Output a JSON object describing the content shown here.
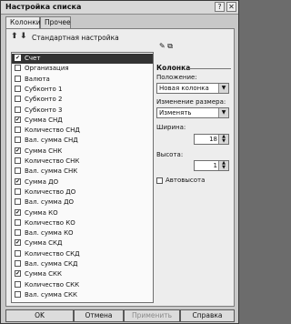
{
  "window": {
    "title": "Настройка списка",
    "help_glyph": "?",
    "close_glyph": "✕"
  },
  "tabs": [
    {
      "label": "Колонки",
      "active": true
    },
    {
      "label": "Прочее",
      "active": false
    }
  ],
  "toolbar": {
    "up_glyph": "⬆",
    "down_glyph": "⬇",
    "label": "Стандартная настройка"
  },
  "list": [
    {
      "label": "Счет",
      "checked": true,
      "selected": true
    },
    {
      "label": "Организация",
      "checked": false
    },
    {
      "label": "Валюта",
      "checked": false
    },
    {
      "label": "Субконто 1",
      "checked": false
    },
    {
      "label": "Субконто 2",
      "checked": false
    },
    {
      "label": "Субконто 3",
      "checked": false
    },
    {
      "label": "Сумма СНД",
      "checked": true
    },
    {
      "label": "Количество СНД",
      "checked": false
    },
    {
      "label": "Вал. сумма СНД",
      "checked": false
    },
    {
      "label": "Сумма СНК",
      "checked": true
    },
    {
      "label": "Количество СНК",
      "checked": false
    },
    {
      "label": "Вал. сумма СНК",
      "checked": false
    },
    {
      "label": "Сумма ДО",
      "checked": true
    },
    {
      "label": "Количество ДО",
      "checked": false
    },
    {
      "label": "Вал. сумма ДО",
      "checked": false
    },
    {
      "label": "Сумма КО",
      "checked": true
    },
    {
      "label": "Количество КО",
      "checked": false
    },
    {
      "label": "Вал. сумма КО",
      "checked": false
    },
    {
      "label": "Сумма СКД",
      "checked": true
    },
    {
      "label": "Количество СКД",
      "checked": false
    },
    {
      "label": "Вал. сумма СКД",
      "checked": false
    },
    {
      "label": "Сумма СКК",
      "checked": true
    },
    {
      "label": "Количество СКК",
      "checked": false
    },
    {
      "label": "Вал. сумма СКК",
      "checked": false
    }
  ],
  "right_icons": "✎ ⧉",
  "column_group": {
    "title": "Колонка",
    "position_label": "Положение:",
    "position_value": "Новая колонка",
    "resize_label": "Изменение размера:",
    "resize_value": "Изменять",
    "width_label": "Ширина:",
    "width_value": "18",
    "height_label": "Высота:",
    "height_value": "1",
    "autoheight_label": "Автовысота"
  },
  "buttons": {
    "ok": "OK",
    "cancel": "Отмена",
    "apply": "Применить",
    "help": "Справка"
  }
}
